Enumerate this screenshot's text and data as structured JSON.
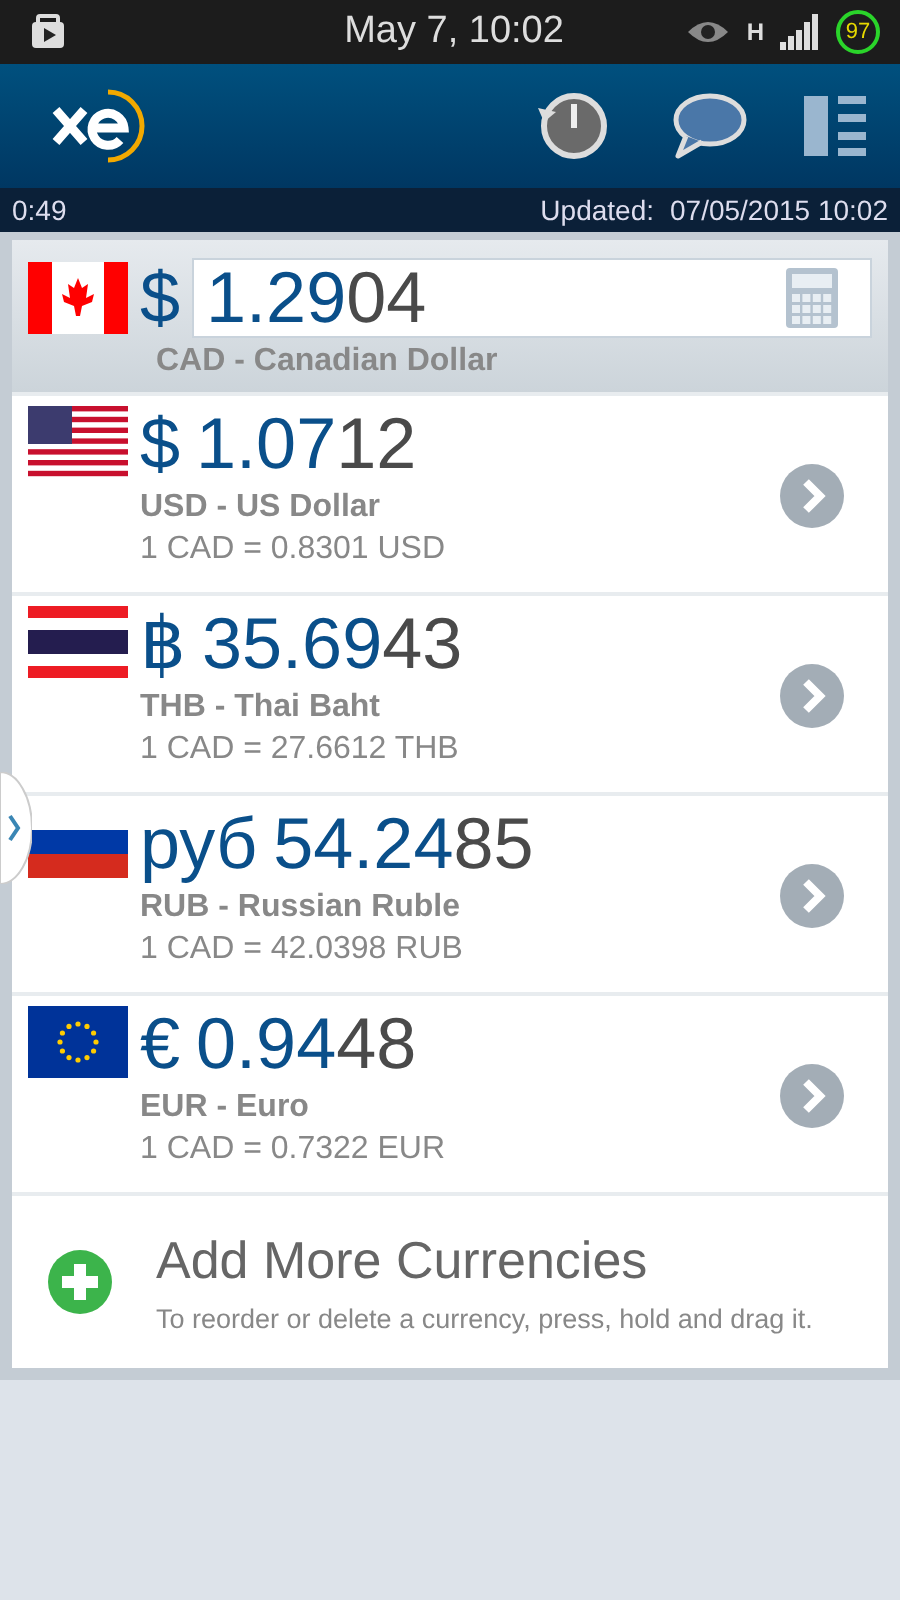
{
  "status_bar": {
    "time": "May 7, 10:02",
    "network": "H",
    "battery": "97"
  },
  "header": {
    "countdown": "0:49",
    "updated_label": "Updated:",
    "updated": "07/05/2015 10:02"
  },
  "base": {
    "kind": "canada",
    "symbol": "$",
    "amount_lead": "1.29",
    "amount_tail": "04",
    "name": "CAD - Canadian Dollar"
  },
  "currencies": [
    {
      "kind": "usa",
      "symbol": "$",
      "amount_lead": "1.07",
      "amount_tail": "12",
      "name": "USD - US Dollar",
      "rate": "1 CAD = 0.8301 USD"
    },
    {
      "kind": "thailand",
      "symbol": "฿",
      "amount_lead": "35.69",
      "amount_tail": "43",
      "name": "THB - Thai Baht",
      "rate": "1 CAD = 27.6612 THB"
    },
    {
      "kind": "russia",
      "symbol": "руб",
      "amount_lead": "54.24",
      "amount_tail": "85",
      "name": "RUB - Russian Ruble",
      "rate": "1 CAD = 42.0398 RUB"
    },
    {
      "kind": "eu",
      "symbol": "€",
      "amount_lead": "0.94",
      "amount_tail": "48",
      "name": "EUR - Euro",
      "rate": "1 CAD = 0.7322 EUR"
    }
  ],
  "add": {
    "title": "Add More Currencies",
    "hint": "To reorder or delete a currency, press, hold and drag it."
  }
}
